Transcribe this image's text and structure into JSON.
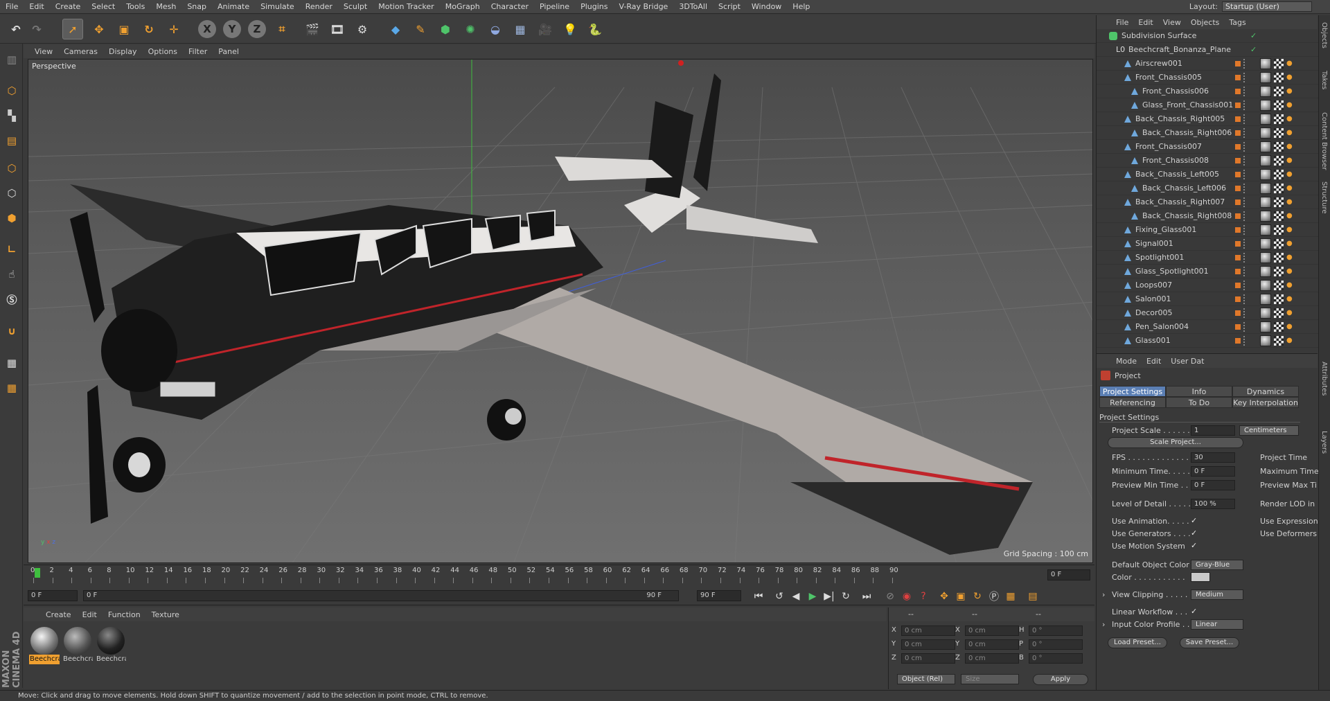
{
  "menu": [
    "File",
    "Edit",
    "Create",
    "Select",
    "Tools",
    "Mesh",
    "Snap",
    "Animate",
    "Simulate",
    "Render",
    "Sculpt",
    "Motion Tracker",
    "MoGraph",
    "Character",
    "Pipeline",
    "Plugins",
    "V-Ray Bridge",
    "3DToAll",
    "Script",
    "Window",
    "Help"
  ],
  "layout": {
    "label": "Layout:",
    "value": "Startup (User)"
  },
  "toolbar_axes": [
    "X",
    "Y",
    "Z"
  ],
  "viewport": {
    "menu": [
      "View",
      "Cameras",
      "Display",
      "Options",
      "Filter",
      "Panel"
    ],
    "label": "Perspective",
    "grid_spacing": "Grid Spacing : 100 cm"
  },
  "timeline": {
    "ticks": [
      "0",
      "2",
      "4",
      "6",
      "8",
      "10",
      "12",
      "14",
      "16",
      "18",
      "20",
      "22",
      "24",
      "26",
      "28",
      "30",
      "32",
      "34",
      "36",
      "38",
      "40",
      "42",
      "44",
      "46",
      "48",
      "50",
      "52",
      "54",
      "56",
      "58",
      "60",
      "62",
      "64",
      "66",
      "68",
      "70",
      "72",
      "74",
      "76",
      "78",
      "80",
      "82",
      "84",
      "86",
      "88",
      "90"
    ],
    "current_frame": "0 F"
  },
  "transport": {
    "start": "0 F",
    "range_start": "0 F",
    "range_end": "90 F",
    "end": "90 F"
  },
  "material_manager": {
    "menu": [
      "Create",
      "Edit",
      "Function",
      "Texture"
    ],
    "materials": [
      {
        "label": "Beechcra",
        "selected": true,
        "color": "#f0a030"
      },
      {
        "label": "Beechcra",
        "selected": false,
        "color": "#cccccc"
      },
      {
        "label": "Beechcra",
        "selected": false,
        "color": "#cccccc"
      }
    ]
  },
  "coords": {
    "headers": [
      "--",
      "--",
      "--"
    ],
    "rows": [
      {
        "a": "X",
        "av": "0 cm",
        "b": "X",
        "bv": "0 cm",
        "c": "H",
        "cv": "0 °"
      },
      {
        "a": "Y",
        "av": "0 cm",
        "b": "Y",
        "bv": "0 cm",
        "c": "P",
        "cv": "0 °"
      },
      {
        "a": "Z",
        "av": "0 cm",
        "b": "Z",
        "bv": "0 cm",
        "c": "B",
        "cv": "0 °"
      }
    ],
    "mode": "Object (Rel)",
    "size": "Size",
    "apply": "Apply"
  },
  "status": "Move: Click and drag to move elements. Hold down SHIFT to quantize movement / add to the selection in point mode, CTRL to remove.",
  "object_manager": {
    "menu": [
      "File",
      "Edit",
      "View",
      "Objects",
      "Tags"
    ],
    "objects": [
      {
        "name": "Subdivision Surface",
        "depth": 0
      },
      {
        "name": "Beechcraft_Bonanza_Plane",
        "depth": 1
      },
      {
        "name": "Airscrew001",
        "depth": 2
      },
      {
        "name": "Front_Chassis005",
        "depth": 2
      },
      {
        "name": "Front_Chassis006",
        "depth": 3
      },
      {
        "name": "Glass_Front_Chassis001",
        "depth": 3
      },
      {
        "name": "Back_Chassis_Right005",
        "depth": 2
      },
      {
        "name": "Back_Chassis_Right006",
        "depth": 3
      },
      {
        "name": "Front_Chassis007",
        "depth": 2
      },
      {
        "name": "Front_Chassis008",
        "depth": 3
      },
      {
        "name": "Back_Chassis_Left005",
        "depth": 2
      },
      {
        "name": "Back_Chassis_Left006",
        "depth": 3
      },
      {
        "name": "Back_Chassis_Right007",
        "depth": 2
      },
      {
        "name": "Back_Chassis_Right008",
        "depth": 3
      },
      {
        "name": "Fixing_Glass001",
        "depth": 2
      },
      {
        "name": "Signal001",
        "depth": 2
      },
      {
        "name": "Spotlight001",
        "depth": 2
      },
      {
        "name": "Glass_Spotlight001",
        "depth": 2
      },
      {
        "name": "Loops007",
        "depth": 2
      },
      {
        "name": "Salon001",
        "depth": 2
      },
      {
        "name": "Decor005",
        "depth": 2
      },
      {
        "name": "Pen_Salon004",
        "depth": 2
      },
      {
        "name": "Glass001",
        "depth": 2
      }
    ]
  },
  "attributes": {
    "menu": [
      "Mode",
      "Edit",
      "User Dat"
    ],
    "title": "Project",
    "tabs_row1": [
      "Project Settings",
      "Info",
      "Dynamics"
    ],
    "tabs_row2": [
      "Referencing",
      "To Do",
      "Key Interpolation"
    ],
    "section": "Project Settings",
    "project_scale_label": "Project Scale . . . . . .",
    "project_scale_value": "1",
    "project_scale_unit": "Centimeters",
    "scale_project_btn": "Scale Project...",
    "fps_label": "FPS . . . . . . . . . . . . .",
    "fps_value": "30",
    "project_time_label": "Project Time",
    "min_time_label": "Minimum Time. . . . . .",
    "min_time_value": "0 F",
    "max_time_label": "Maximum Time",
    "preview_min_label": "Preview Min Time . .",
    "preview_min_value": "0 F",
    "preview_max_label": "Preview Max Ti",
    "lod_label": "Level of Detail . . . . .",
    "lod_value": "100 %",
    "render_lod_label": "Render LOD in",
    "use_anim_label": "Use Animation. . . . .",
    "use_expr_label": "Use Expression",
    "use_gen_label": "Use Generators . . . .",
    "use_deform_label": "Use Deformers",
    "use_motion_label": "Use Motion System",
    "default_color_label": "Default Object Color",
    "default_color_value": "Gray-Blue",
    "color_label": "Color . . . . . . . . . . .",
    "view_clipping_label": "View Clipping . . . . .",
    "view_clipping_value": "Medium",
    "linear_workflow_label": "Linear Workflow . . .",
    "input_color_label": "Input Color Profile . .",
    "input_color_value": "Linear",
    "load_preset": "Load Preset...",
    "save_preset": "Save Preset..."
  },
  "right_strip": [
    "Objects",
    "Takes",
    "Content Browser",
    "Structure",
    "Attributes",
    "Layers"
  ],
  "brand": "MAXON CINEMA 4D"
}
